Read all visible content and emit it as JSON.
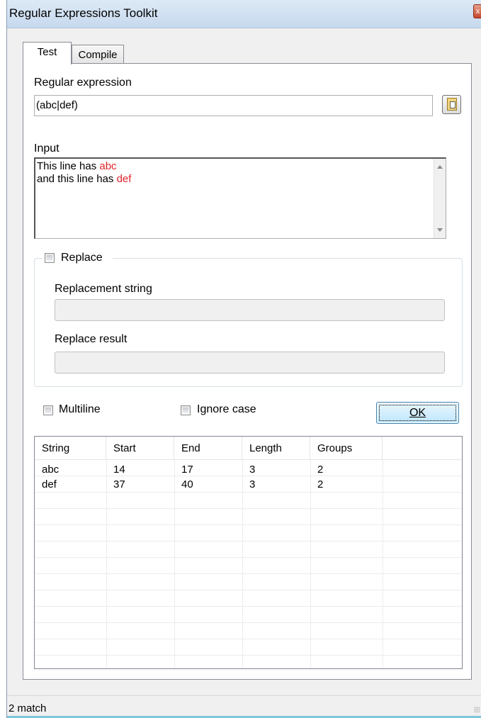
{
  "window": {
    "title": "Regular Expressions Toolkit",
    "close_glyph": "x"
  },
  "tabs": [
    {
      "label": "Test",
      "active": true
    },
    {
      "label": "Compile",
      "active": false
    }
  ],
  "regex": {
    "label": "Regular expression",
    "value": "(abc|def)"
  },
  "input": {
    "label": "Input",
    "lines": [
      {
        "plain": "This line has ",
        "match": "abc"
      },
      {
        "plain": "and this line has ",
        "match": "def"
      }
    ]
  },
  "replace": {
    "checkbox_label": "Replace",
    "checked": false,
    "replacement_label": "Replacement string",
    "replacement_value": "",
    "result_label": "Replace result",
    "result_value": ""
  },
  "options": {
    "multiline_label": "Multiline",
    "multiline_checked": false,
    "ignore_case_label": "Ignore case",
    "ignore_case_checked": false,
    "ok_label": "OK"
  },
  "results": {
    "columns": [
      "String",
      "Start",
      "End",
      "Length",
      "Groups"
    ],
    "rows": [
      [
        "abc",
        "14",
        "17",
        "3",
        "2"
      ],
      [
        "def",
        "37",
        "40",
        "3",
        "2"
      ]
    ]
  },
  "status": {
    "text": "2 match"
  },
  "colors": {
    "match_highlight": "#e0252b"
  }
}
